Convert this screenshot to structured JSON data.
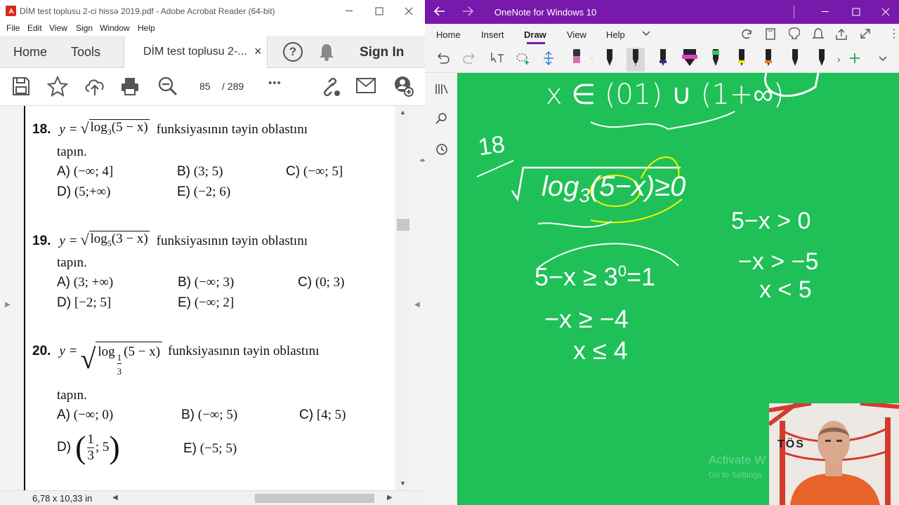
{
  "acrobat": {
    "title": "DİM test toplusu 2-ci hissə 2019.pdf - Adobe Acrobat Reader (64-bit)",
    "menu": [
      "File",
      "Edit",
      "View",
      "Sign",
      "Window",
      "Help"
    ],
    "tabs": {
      "home": "Home",
      "tools": "Tools",
      "doc": "DİM test toplusu 2-...",
      "close": "×"
    },
    "sign_in": "Sign In",
    "page_current": "85",
    "page_total": "/ 289",
    "more": "•••",
    "status_size": "6,78 x 10,33 in",
    "questions": [
      {
        "num": "18.",
        "y": "y =",
        "fn": "log",
        "base": "3",
        "arg": "(5 − x)",
        "text": "funksiyasının təyin oblastını",
        "tapin": "tapın.",
        "options": [
          {
            "l": "A)",
            "v": "(−∞; 4]"
          },
          {
            "l": "B)",
            "v": "(3; 5)"
          },
          {
            "l": "C)",
            "v": "(−∞; 5]"
          },
          {
            "l": "D)",
            "v": "(5;+∞)"
          },
          {
            "l": "E)",
            "v": "(−2; 6)"
          }
        ]
      },
      {
        "num": "19.",
        "y": "y =",
        "fn": "log",
        "base": "5",
        "arg": "(3 − x)",
        "text": "funksiyasının təyin oblastını",
        "tapin": "tapın.",
        "options": [
          {
            "l": "A)",
            "v": "(3; +∞)"
          },
          {
            "l": "B)",
            "v": "(−∞; 3)"
          },
          {
            "l": "C)",
            "v": "(0; 3)"
          },
          {
            "l": "D)",
            "v": "[−2; 5]"
          },
          {
            "l": "E)",
            "v": "(−∞; 2]"
          }
        ]
      },
      {
        "num": "20.",
        "y": "y =",
        "fn": "log",
        "base_num": "1",
        "base_den": "3",
        "arg": "(5 − x)",
        "text": "funksiyasının təyin oblastını",
        "tapin": "tapın.",
        "options": [
          {
            "l": "A)",
            "v": "(−∞; 0)"
          },
          {
            "l": "B)",
            "v": "(−∞; 5)"
          },
          {
            "l": "C)",
            "v": "[4; 5)"
          },
          {
            "l": "D)",
            "v_num": "1",
            "v_den": "3",
            "v_rest": "; 5"
          },
          {
            "l": "E)",
            "v": "(−5; 5)"
          }
        ]
      }
    ]
  },
  "onenote": {
    "title": "OneNote for Windows 10",
    "tabs": [
      "Home",
      "Insert",
      "Draw",
      "View",
      "Help"
    ],
    "active_tab": "Draw",
    "watermark": [
      "Activate W",
      "Go to Settings"
    ],
    "webcam_logo": "TÖS",
    "ink": {
      "top": "x ∈ (01) ∪ (1+∞)",
      "num": "18",
      "main": "log",
      "base": "3",
      "arg": "(5−x)",
      "ge0": "≥0",
      "l1": "5−x ≥ 3",
      "exp": "0",
      "eq1": "=1",
      "l2": "−x ≥ −4",
      "l3": "x ≤ 4",
      "r1": "5−x > 0",
      "r2": "−x > −5",
      "r3": "x < 5"
    },
    "colors": {
      "title_bar": "#7719aa",
      "canvas": "#1fc058",
      "ink_white": "#ffffff",
      "ink_yellow": "#f5f500"
    }
  }
}
